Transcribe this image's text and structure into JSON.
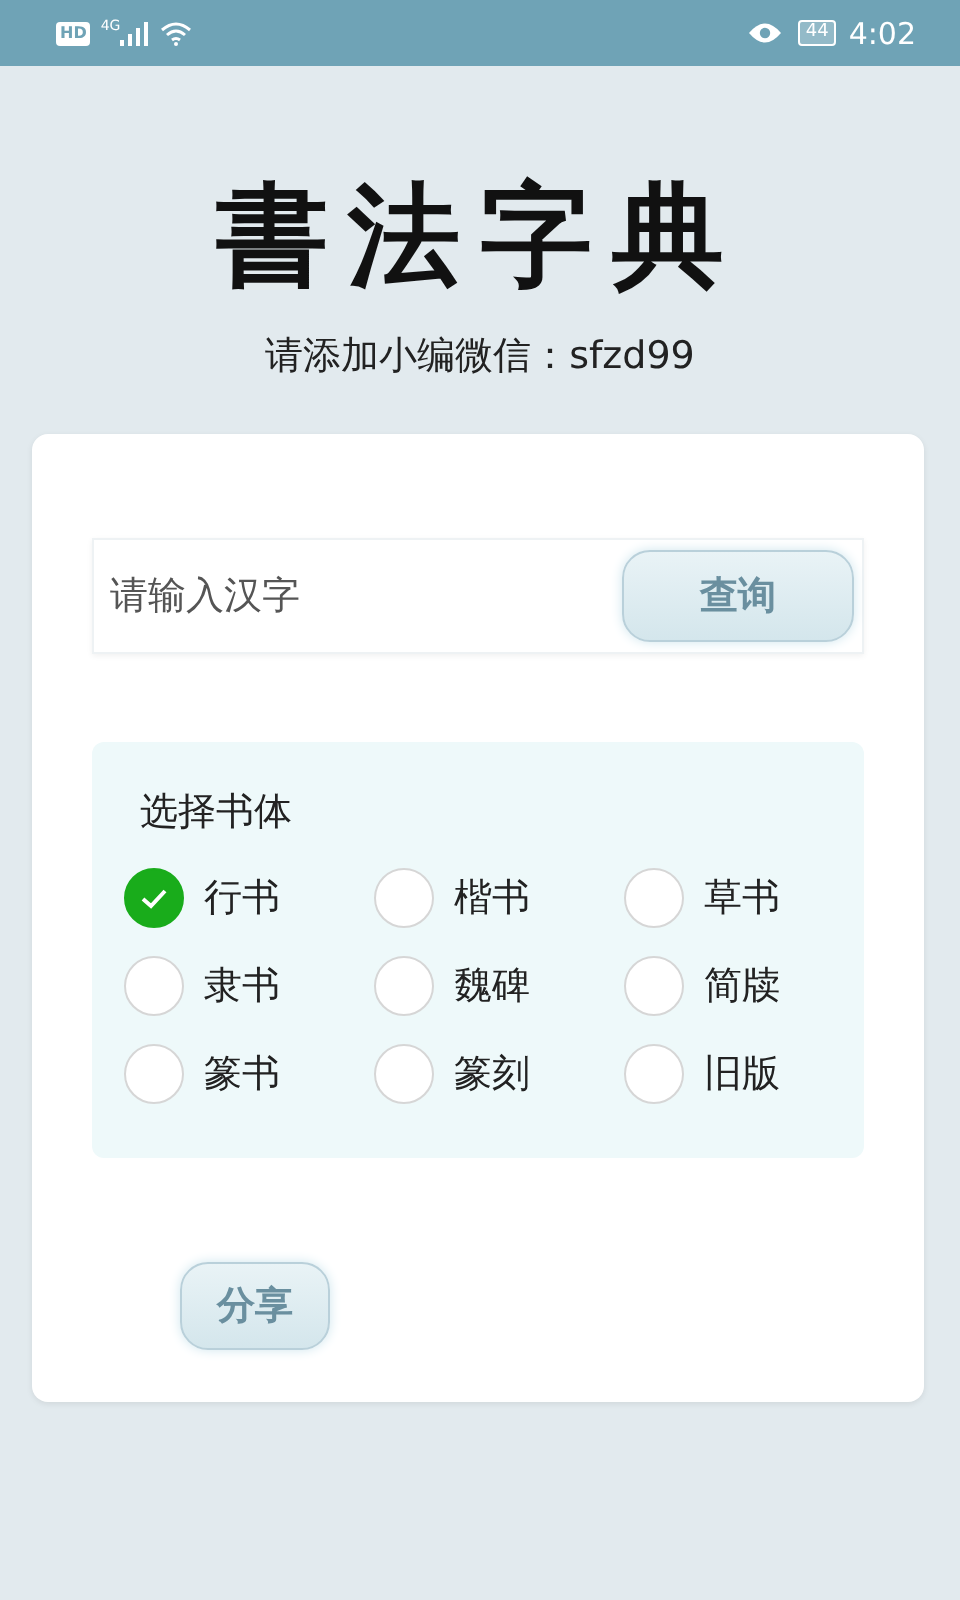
{
  "status_bar": {
    "hd": "HD",
    "network": "4G",
    "battery": "44",
    "time": "4:02"
  },
  "logo": "書法字典",
  "subtitle": "请添加小编微信：sfzd99",
  "search": {
    "placeholder": "请输入汉字",
    "button": "查询"
  },
  "font_style": {
    "title": "选择书体",
    "options": [
      {
        "label": "行书",
        "selected": true
      },
      {
        "label": "楷书",
        "selected": false
      },
      {
        "label": "草书",
        "selected": false
      },
      {
        "label": "隶书",
        "selected": false
      },
      {
        "label": "魏碑",
        "selected": false
      },
      {
        "label": "简牍",
        "selected": false
      },
      {
        "label": "篆书",
        "selected": false
      },
      {
        "label": "篆刻",
        "selected": false
      },
      {
        "label": "旧版",
        "selected": false
      }
    ]
  },
  "share_button": "分享"
}
